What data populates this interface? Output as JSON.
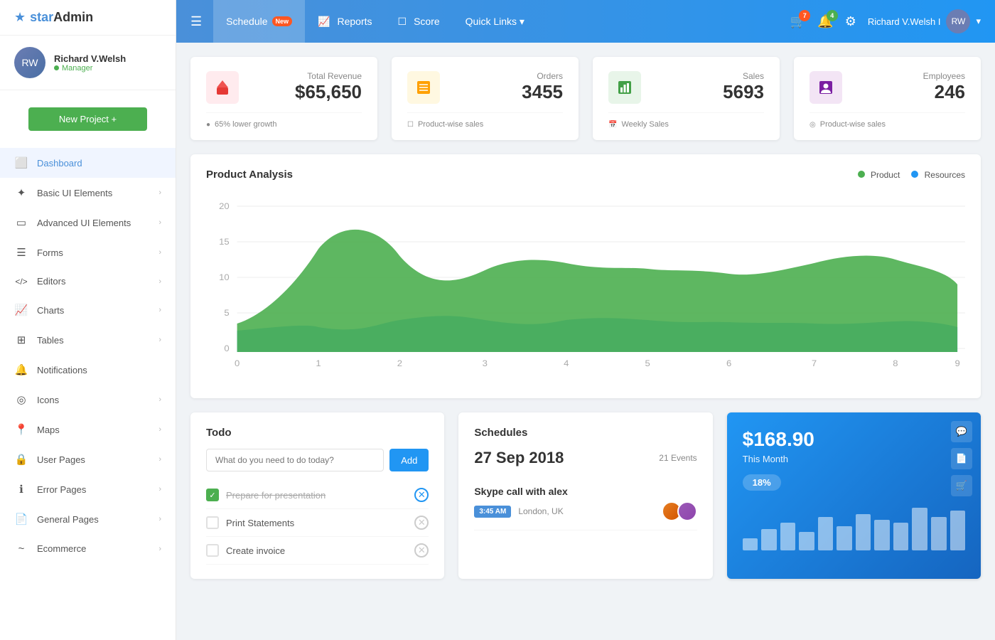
{
  "brand": {
    "star": "star",
    "admin": "Admin",
    "icon": "★"
  },
  "profile": {
    "name": "Richard V.Welsh",
    "role": "Manager",
    "avatar_initials": "RW"
  },
  "new_project_label": "New Project +",
  "sidebar": {
    "items": [
      {
        "id": "dashboard",
        "label": "Dashboard",
        "icon": "⬜",
        "active": true,
        "has_arrow": false
      },
      {
        "id": "basic-ui",
        "label": "Basic UI Elements",
        "icon": "✦",
        "active": false,
        "has_arrow": true
      },
      {
        "id": "advanced-ui",
        "label": "Advanced UI Elements",
        "icon": "▭",
        "active": false,
        "has_arrow": true
      },
      {
        "id": "forms",
        "label": "Forms",
        "icon": "☰",
        "active": false,
        "has_arrow": true
      },
      {
        "id": "editors",
        "label": "Editors",
        "icon": "<>",
        "active": false,
        "has_arrow": true
      },
      {
        "id": "charts",
        "label": "Charts",
        "icon": "📈",
        "active": false,
        "has_arrow": true
      },
      {
        "id": "tables",
        "label": "Tables",
        "icon": "⊞",
        "active": false,
        "has_arrow": true
      },
      {
        "id": "notifications",
        "label": "Notifications",
        "icon": "🔔",
        "active": false,
        "has_arrow": false
      },
      {
        "id": "icons",
        "label": "Icons",
        "icon": "◎",
        "active": false,
        "has_arrow": true
      },
      {
        "id": "maps",
        "label": "Maps",
        "icon": "📍",
        "active": false,
        "has_arrow": true
      },
      {
        "id": "user-pages",
        "label": "User Pages",
        "icon": "🔒",
        "active": false,
        "has_arrow": true
      },
      {
        "id": "error-pages",
        "label": "Error Pages",
        "icon": "ℹ",
        "active": false,
        "has_arrow": true
      },
      {
        "id": "general-pages",
        "label": "General Pages",
        "icon": "📄",
        "active": false,
        "has_arrow": true
      },
      {
        "id": "ecommerce",
        "label": "Ecommerce",
        "icon": "~",
        "active": false,
        "has_arrow": true
      }
    ]
  },
  "topbar": {
    "menu_icon": "☰",
    "nav_items": [
      {
        "id": "schedule",
        "label": "Schedule",
        "badge": "New",
        "active": true
      },
      {
        "id": "reports",
        "label": "Reports",
        "active": false
      },
      {
        "id": "score",
        "label": "Score",
        "active": false
      },
      {
        "id": "quick-links",
        "label": "Quick Links ▾",
        "active": false
      }
    ],
    "cart_badge": "7",
    "bell_badge": "4",
    "user_name": "Richard V.Welsh I",
    "user_avatar": "RW"
  },
  "stats": [
    {
      "id": "revenue",
      "label": "Total Revenue",
      "value": "$65,650",
      "icon": "📦",
      "icon_color": "red",
      "footer_icon": "●",
      "footer_text": "65% lower growth"
    },
    {
      "id": "orders",
      "label": "Orders",
      "value": "3455",
      "icon": "📋",
      "icon_color": "orange",
      "footer_icon": "☐",
      "footer_text": "Product-wise sales"
    },
    {
      "id": "sales",
      "label": "Sales",
      "value": "5693",
      "icon": "📊",
      "icon_color": "green",
      "footer_icon": "📅",
      "footer_text": "Weekly Sales"
    },
    {
      "id": "employees",
      "label": "Employees",
      "value": "246",
      "icon": "👤",
      "icon_color": "purple",
      "footer_icon": "◎",
      "footer_text": "Product-wise sales"
    }
  ],
  "chart": {
    "title": "Product Analysis",
    "legend": [
      {
        "id": "product",
        "label": "Product",
        "color": "#4caf50"
      },
      {
        "id": "resources",
        "label": "Resources",
        "color": "#2196f3"
      }
    ],
    "x_labels": [
      "0",
      "1",
      "2",
      "3",
      "4",
      "5",
      "6",
      "7",
      "8",
      "9"
    ],
    "y_labels": [
      "0",
      "5",
      "10",
      "15",
      "20"
    ]
  },
  "todo": {
    "title": "Todo",
    "input_placeholder": "What do you need to do today?",
    "add_button_label": "Add",
    "items": [
      {
        "text": "Prepare for presentation",
        "checked": true
      },
      {
        "text": "Print Statements",
        "checked": false
      },
      {
        "text": "Create invoice",
        "checked": false
      }
    ]
  },
  "schedules": {
    "title": "Schedules",
    "date": "27 Sep 2018",
    "events_count": "21 Events",
    "items": [
      {
        "title": "Skype call with alex",
        "time": "3:45 AM",
        "location": "London, UK"
      }
    ]
  },
  "revenue_widget": {
    "amount": "$168.90",
    "label": "This Month",
    "percent": "18%",
    "bars": [
      20,
      35,
      45,
      30,
      55,
      40,
      60,
      50,
      45,
      70,
      55,
      65
    ]
  }
}
